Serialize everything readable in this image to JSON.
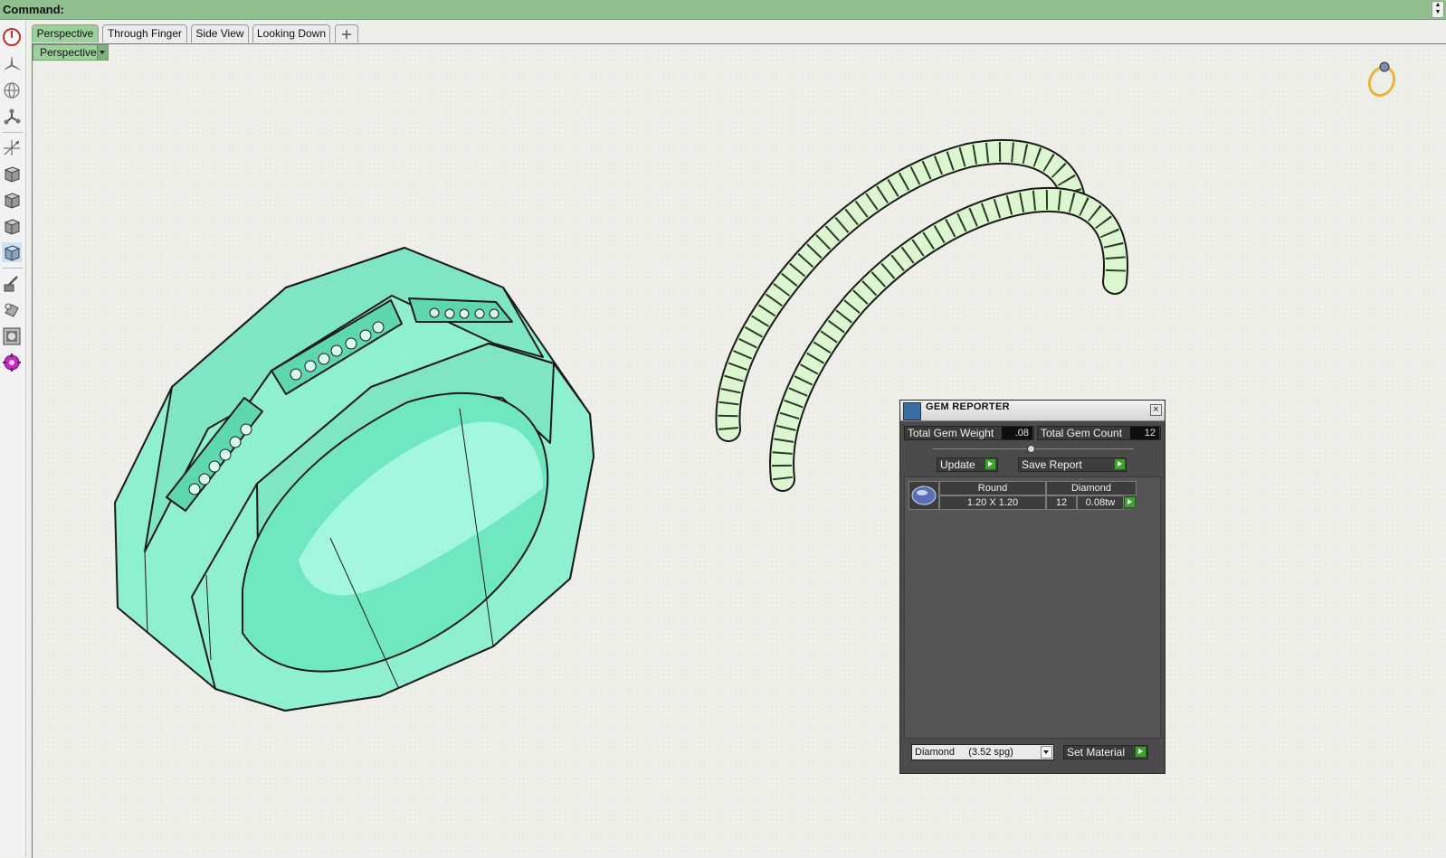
{
  "command_bar": {
    "label": "Command:"
  },
  "tabs": [
    {
      "label": "Perspective",
      "active": true
    },
    {
      "label": "Through Finger",
      "active": false
    },
    {
      "label": "Side View",
      "active": false
    },
    {
      "label": "Looking Down",
      "active": false
    }
  ],
  "tab_add_icon": "plus-icon",
  "viewport": {
    "label": "Perspective"
  },
  "left_toolbar": {
    "tools": [
      "power-icon",
      "plane-icon",
      "globe-icon",
      "node-icon",
      "axes-icon",
      "cube-icon",
      "cube-front-icon",
      "cube-side-icon",
      "cube-top-icon",
      "paint-icon",
      "light-icon",
      "render-icon",
      "gear-settings-icon"
    ]
  },
  "gem_reporter": {
    "title": "GEM REPORTER",
    "total_gem_weight_label": "Total Gem Weight",
    "total_gem_weight_value": ".08",
    "total_gem_count_label": "Total Gem Count",
    "total_gem_count_value": "12",
    "update_label": "Update",
    "save_report_label": "Save Report",
    "table": {
      "headers": [
        "Round",
        "Diamond"
      ],
      "rows": [
        {
          "size": "1.20 X 1.20",
          "count": "12",
          "weight": "0.08tw"
        }
      ]
    },
    "material_select": "Diamond     (3.52 spg)",
    "set_material_label": "Set Material"
  },
  "colors": {
    "ring_fill": "#8ef0d0",
    "rope_fill": "#dcf7cf",
    "command_bar": "#8fbe8f",
    "active_tab": "#9ccf9c",
    "panel_bg": "#4b4b4b",
    "accent_green": "#3fa12e"
  }
}
